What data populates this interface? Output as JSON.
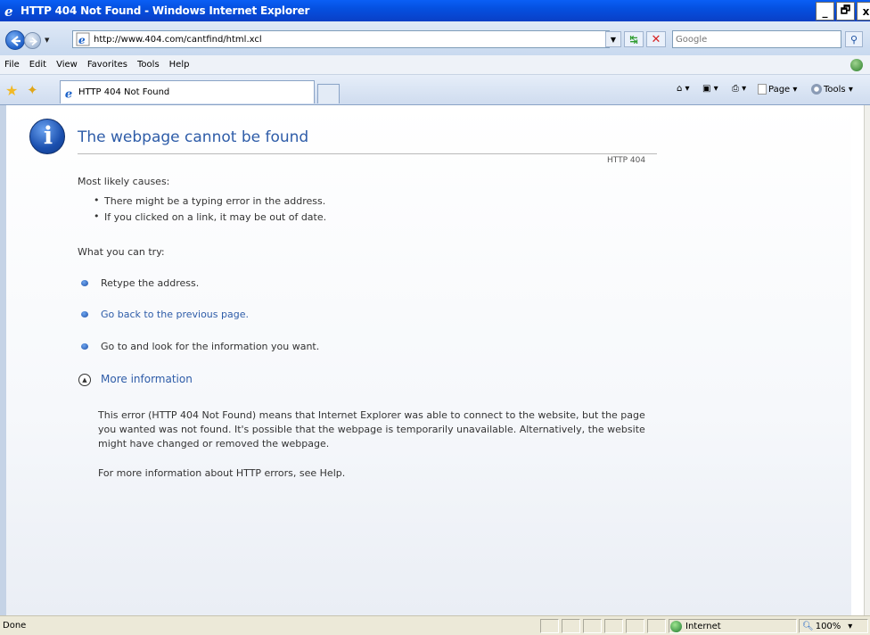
{
  "window": {
    "title": "HTTP 404 Not Found - Windows Internet Explorer",
    "title_buttons": [
      "_",
      "🗗",
      "x"
    ]
  },
  "address_bar": {
    "url": "http://www.404.com/cantfind/html.xcl",
    "search_placeholder": "Google"
  },
  "menu": {
    "items": [
      "File",
      "Edit",
      "View",
      "Favorites",
      "Tools",
      "Help"
    ]
  },
  "tabs": {
    "active_label": "HTTP 404 Not Found"
  },
  "command_bar": {
    "page_label": "Page",
    "tools_label": "Tools"
  },
  "content": {
    "heading": "The webpage cannot be found",
    "http_code": "HTTP 404",
    "causes_title": "Most likely causes:",
    "causes": [
      "There might be a typing error in the address.",
      "If you clicked on a link, it may be out of date."
    ],
    "try_title": "What you can try:",
    "try_items": [
      "Retype the address.",
      "Go back to the previous page.",
      "Go to  and look for the information you want."
    ],
    "more_info": "More information",
    "explanation": "This error (HTTP 404 Not Found) means that Internet Explorer was able to connect to the website, but the page you wanted was not found. It's possible that the webpage is temporarily unavailable. Alternatively, the website might have changed or removed the webpage.",
    "help_text": "For more information about HTTP errors, see Help."
  },
  "status_bar": {
    "status": "Done",
    "zone": "Internet",
    "zoom": "100%"
  }
}
